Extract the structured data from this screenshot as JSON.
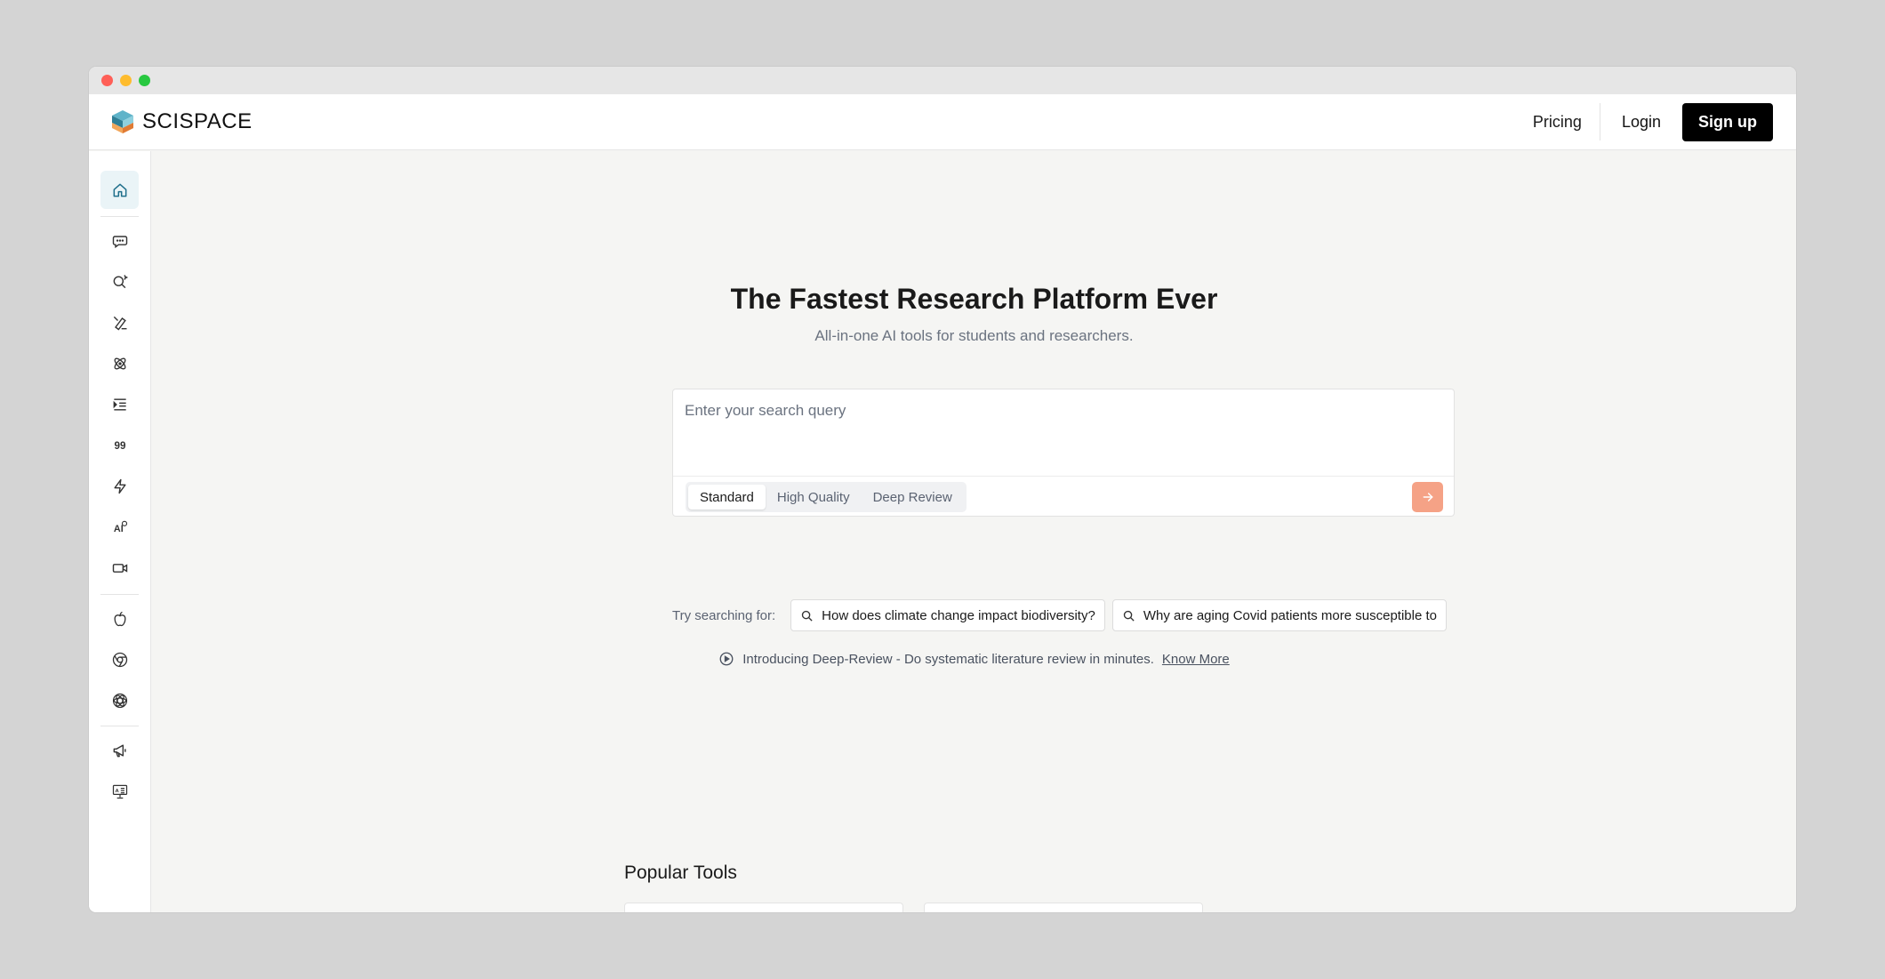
{
  "brand": {
    "name": "SCISPACE"
  },
  "nav": {
    "pricing": "Pricing",
    "login": "Login",
    "signup": "Sign up"
  },
  "sidebar": {
    "items": [
      {
        "name": "home-icon"
      },
      {
        "name": "chat-icon"
      },
      {
        "name": "search-icon"
      },
      {
        "name": "pen-icon"
      },
      {
        "name": "atom-icon"
      },
      {
        "name": "outline-icon"
      },
      {
        "name": "quote-icon"
      },
      {
        "name": "lightning-icon"
      },
      {
        "name": "ai-detect-icon"
      },
      {
        "name": "video-icon"
      },
      {
        "name": "apple-icon"
      },
      {
        "name": "chrome-icon"
      },
      {
        "name": "openai-icon"
      },
      {
        "name": "megaphone-icon"
      },
      {
        "name": "presentation-icon"
      }
    ]
  },
  "hero": {
    "title": "The Fastest Research Platform Ever",
    "subtitle": "All-in-one AI tools for students and researchers."
  },
  "search": {
    "placeholder": "Enter your search query",
    "modes": [
      "Standard",
      "High Quality",
      "Deep Review"
    ],
    "selected_mode": "Standard"
  },
  "suggestions": {
    "label": "Try searching for:",
    "items": [
      "How does climate change impact biodiversity?",
      "Why are aging Covid patients more susceptible to"
    ]
  },
  "intro": {
    "text": "Introducing Deep-Review - Do systematic literature review in minutes.",
    "link": "Know More"
  },
  "popular": {
    "title": "Popular Tools",
    "tools": [
      {
        "icon": "chat-icon",
        "color": "#f06a2c",
        "bg": "#fdf1ec"
      },
      {
        "icon": "pen-icon",
        "color": "#1f6f8b",
        "bg": "#eaf3f6"
      }
    ]
  },
  "colors": {
    "accent": "#f5a286",
    "primary": "#000000"
  }
}
